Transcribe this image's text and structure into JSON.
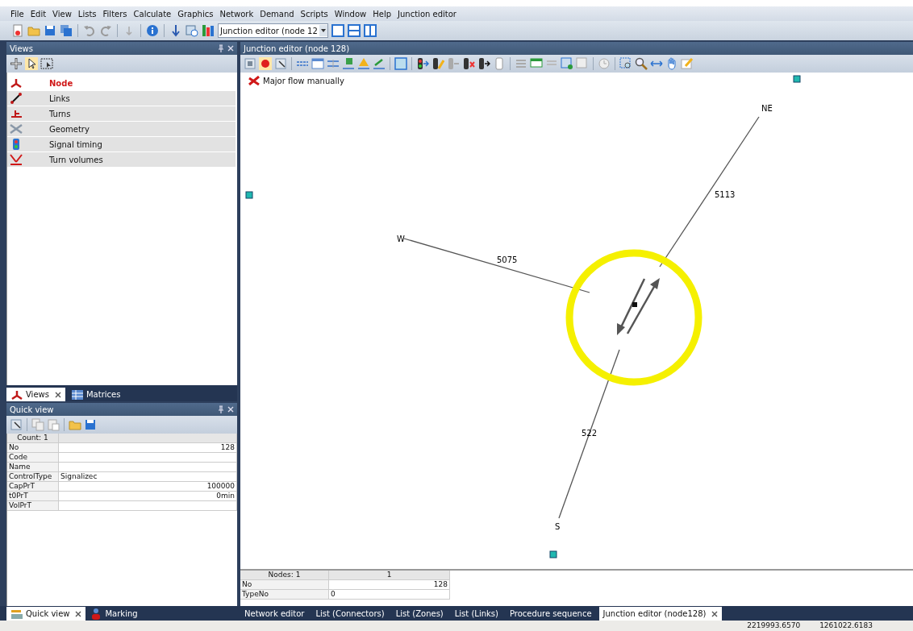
{
  "menu": [
    "File",
    "Edit",
    "View",
    "Lists",
    "Filters",
    "Calculate",
    "Graphics",
    "Network",
    "Demand",
    "Scripts",
    "Window",
    "Help",
    "Junction editor"
  ],
  "toolbar": {
    "view_selector": "Junction editor (node 12"
  },
  "views_panel": {
    "title": "Views",
    "items": [
      {
        "label": "Node",
        "selected": true
      },
      {
        "label": "Links",
        "selected": false
      },
      {
        "label": "Turns",
        "selected": false
      },
      {
        "label": "Geometry",
        "selected": false
      },
      {
        "label": "Signal timing",
        "selected": false
      },
      {
        "label": "Turn volumes",
        "selected": false
      }
    ],
    "tabs": [
      {
        "label": "Views",
        "selected": true
      },
      {
        "label": "Matrices",
        "selected": false
      }
    ]
  },
  "quick_view": {
    "title": "Quick view",
    "header": "Count: 1",
    "rows": [
      {
        "label": "No",
        "value": "128",
        "kind": "number"
      },
      {
        "label": "Code",
        "kind": "text"
      },
      {
        "label": "Name",
        "kind": "text"
      },
      {
        "label": "ControlType",
        "value": "Signalizec",
        "kind": "text"
      },
      {
        "label": "CapPrT",
        "value": "100000",
        "kind": "number"
      },
      {
        "label": "t0PrT",
        "value": "0min",
        "kind": "number"
      },
      {
        "label": "VolPrT",
        "kind": "number"
      }
    ],
    "tabs": [
      {
        "label": "Quick view",
        "selected": true
      },
      {
        "label": "Marking",
        "selected": false
      }
    ]
  },
  "junction_editor": {
    "title": "Junction editor (node 128)",
    "legend": "Major flow manually",
    "approaches": [
      {
        "name": "NE",
        "link": "5113"
      },
      {
        "name": "W",
        "link": "5075"
      },
      {
        "name": "S",
        "link": "522"
      }
    ]
  },
  "node_grid": {
    "header": [
      "Nodes: 1",
      "1"
    ],
    "rows": [
      {
        "label": "No",
        "value": "128",
        "kind": "number"
      },
      {
        "label": "TypeNo",
        "value": "0",
        "kind": "text"
      }
    ]
  },
  "document_tabs": [
    {
      "label": "Network editor",
      "selected": false
    },
    {
      "label": "List (Connectors)",
      "selected": false
    },
    {
      "label": "List (Zones)",
      "selected": false
    },
    {
      "label": "List (Links)",
      "selected": false
    },
    {
      "label": "Procedure sequence",
      "selected": false
    },
    {
      "label": "Junction editor (node128)",
      "selected": true
    }
  ],
  "status_bar": [
    "2219993.6570",
    "1261022.6183"
  ]
}
